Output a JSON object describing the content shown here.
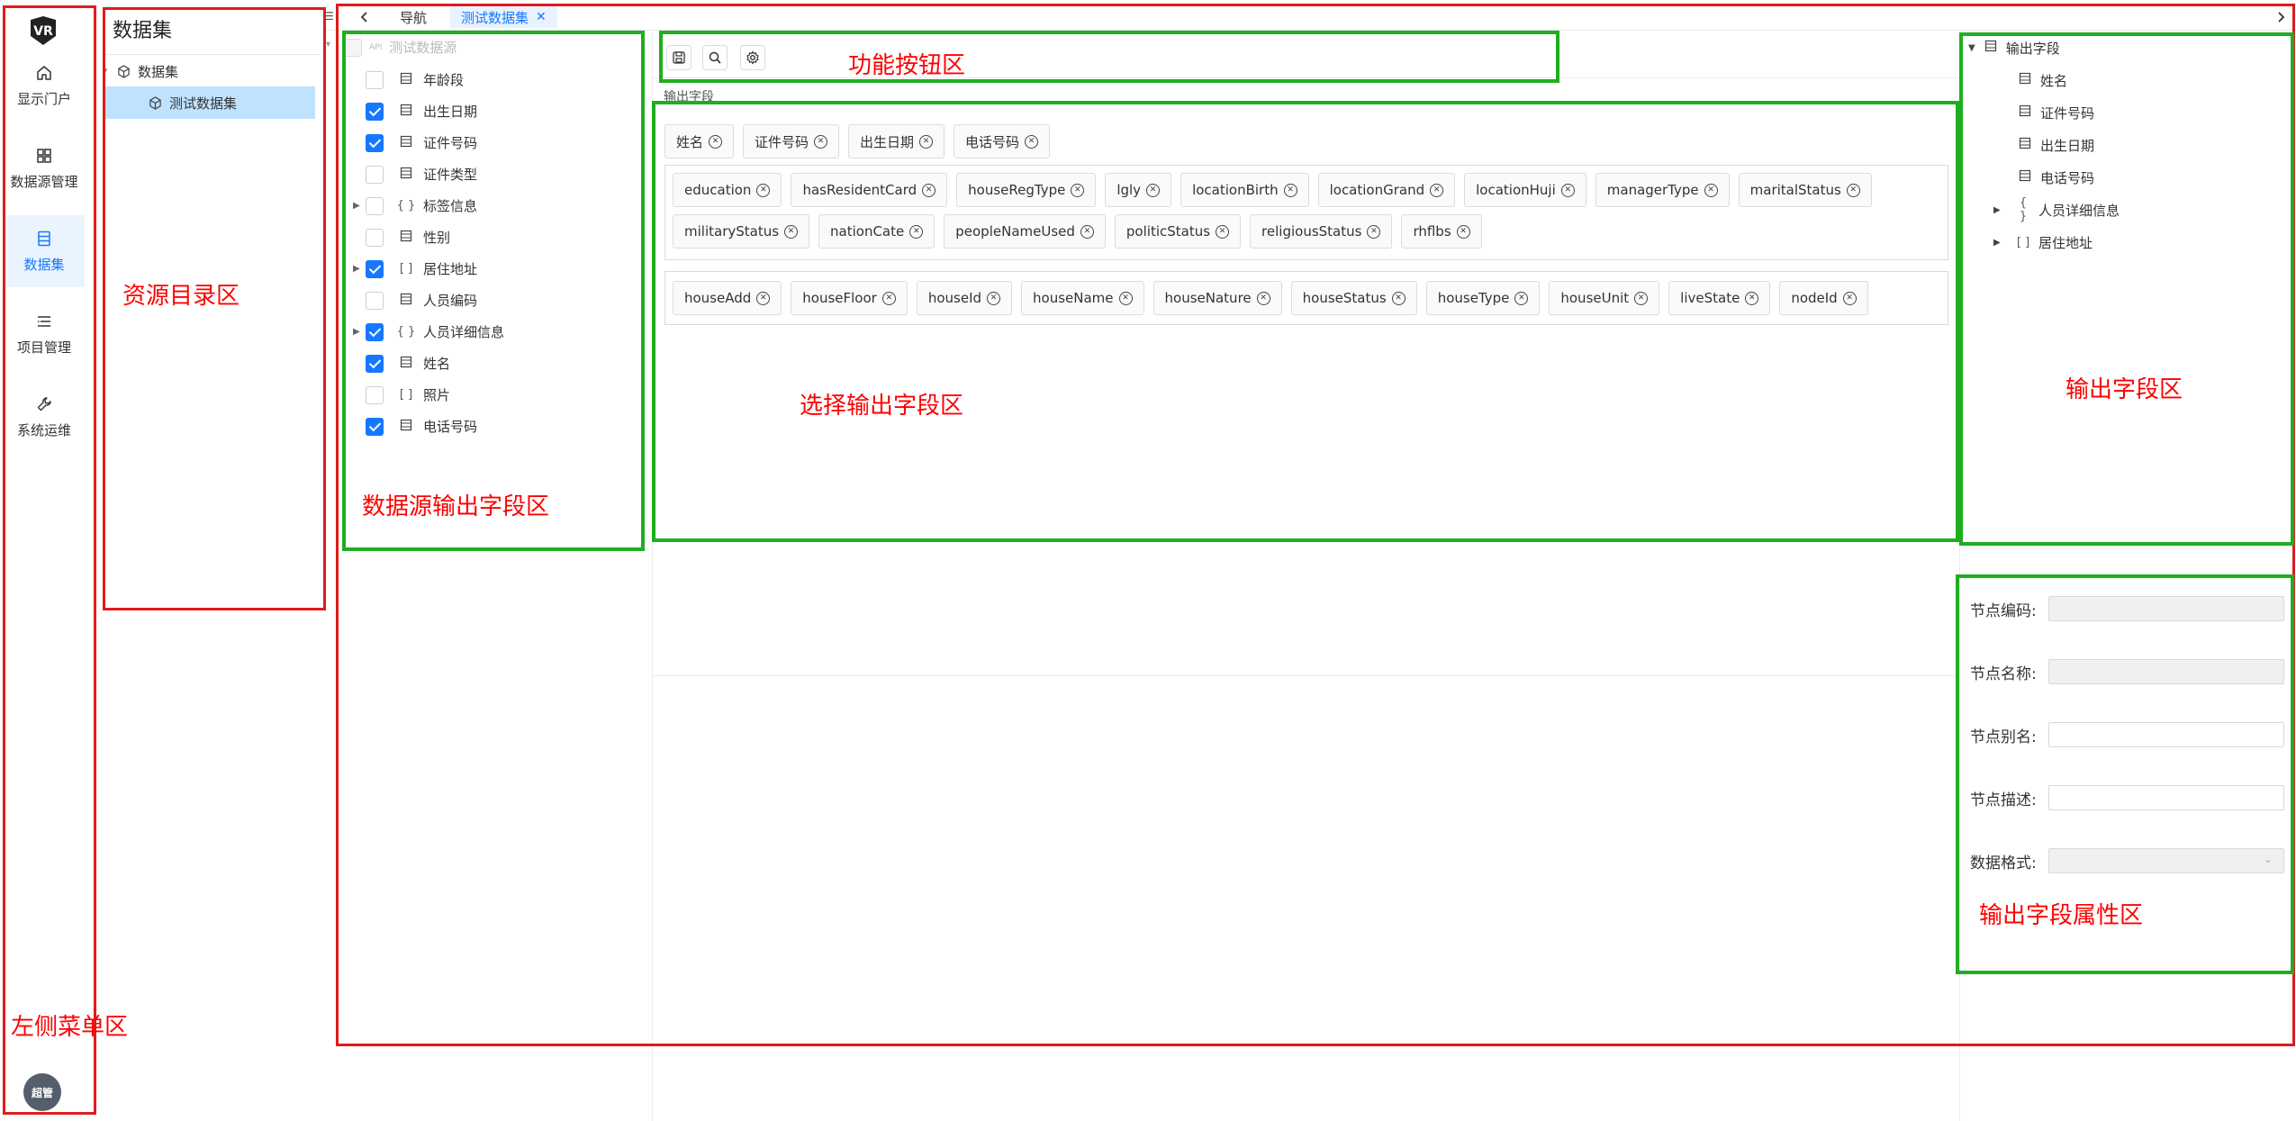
{
  "left_menu": {
    "items": [
      {
        "label": "显示门户",
        "icon": "home-icon"
      },
      {
        "label": "数据源管理",
        "icon": "grid-icon"
      },
      {
        "label": "数据集",
        "icon": "list-doc-icon"
      },
      {
        "label": "项目管理",
        "icon": "list-icon"
      },
      {
        "label": "系统运维",
        "icon": "wrench-icon"
      }
    ],
    "active_index": 2,
    "avatar_text": "超管"
  },
  "directory": {
    "title": "数据集",
    "root": "数据集",
    "child": "测试数据集"
  },
  "tabs": {
    "items": [
      {
        "label": "导航",
        "active": false
      },
      {
        "label": "测试数据集",
        "active": true
      }
    ]
  },
  "source_fields": {
    "header": "测试数据源",
    "rows": [
      {
        "label": "年龄段",
        "checked": false,
        "type": "field",
        "expandable": false
      },
      {
        "label": "出生日期",
        "checked": true,
        "type": "field",
        "expandable": false
      },
      {
        "label": "证件号码",
        "checked": true,
        "type": "field",
        "expandable": false
      },
      {
        "label": "证件类型",
        "checked": false,
        "type": "field",
        "expandable": false
      },
      {
        "label": "标签信息",
        "checked": false,
        "type": "object",
        "expandable": true
      },
      {
        "label": "性别",
        "checked": false,
        "type": "field",
        "expandable": false
      },
      {
        "label": "居住地址",
        "checked": true,
        "type": "array",
        "expandable": true
      },
      {
        "label": "人员编码",
        "checked": false,
        "type": "field",
        "expandable": false
      },
      {
        "label": "人员详细信息",
        "checked": true,
        "type": "object",
        "expandable": true
      },
      {
        "label": "姓名",
        "checked": true,
        "type": "field",
        "expandable": false
      },
      {
        "label": "照片",
        "checked": false,
        "type": "array",
        "expandable": false
      },
      {
        "label": "电话号码",
        "checked": true,
        "type": "field",
        "expandable": false
      }
    ]
  },
  "output_section_label": "输出字段",
  "selected_tags": {
    "top": [
      "姓名",
      "证件号码",
      "出生日期",
      "电话号码"
    ],
    "group1": [
      "education",
      "hasResidentCard",
      "houseRegType",
      "lgly",
      "locationBirth",
      "locationGrand",
      "locationHuji",
      "managerType",
      "maritalStatus",
      "militaryStatus",
      "nationCate",
      "peopleNameUsed",
      "politicStatus",
      "religiousStatus",
      "rhflbs"
    ],
    "group2": [
      "houseAdd",
      "houseFloor",
      "houseId",
      "houseName",
      "houseNature",
      "houseStatus",
      "houseType",
      "houseUnit",
      "liveState",
      "nodeId"
    ]
  },
  "output_tree": {
    "root": "输出字段",
    "children": [
      {
        "label": "姓名",
        "type": "field",
        "expandable": false
      },
      {
        "label": "证件号码",
        "type": "field",
        "expandable": false
      },
      {
        "label": "出生日期",
        "type": "field",
        "expandable": false
      },
      {
        "label": "电话号码",
        "type": "field",
        "expandable": false
      },
      {
        "label": "人员详细信息",
        "type": "object",
        "expandable": true
      },
      {
        "label": "居住地址",
        "type": "array",
        "expandable": true
      }
    ]
  },
  "properties": {
    "fields": [
      {
        "label": "节点编码:",
        "disabled": true
      },
      {
        "label": "节点名称:",
        "disabled": true
      },
      {
        "label": "节点别名:",
        "disabled": false
      },
      {
        "label": "节点描述:",
        "disabled": false
      },
      {
        "label": "数据格式:",
        "disabled": true,
        "select": true
      }
    ]
  },
  "annotations": {
    "left_menu": "左侧菜单区",
    "resource_dir": "资源目录区",
    "source_fields": "数据源输出字段区",
    "toolbar": "功能按钮区",
    "select_output": "选择输出字段区",
    "output_fields": "输出字段区",
    "output_props": "输出字段属性区"
  }
}
